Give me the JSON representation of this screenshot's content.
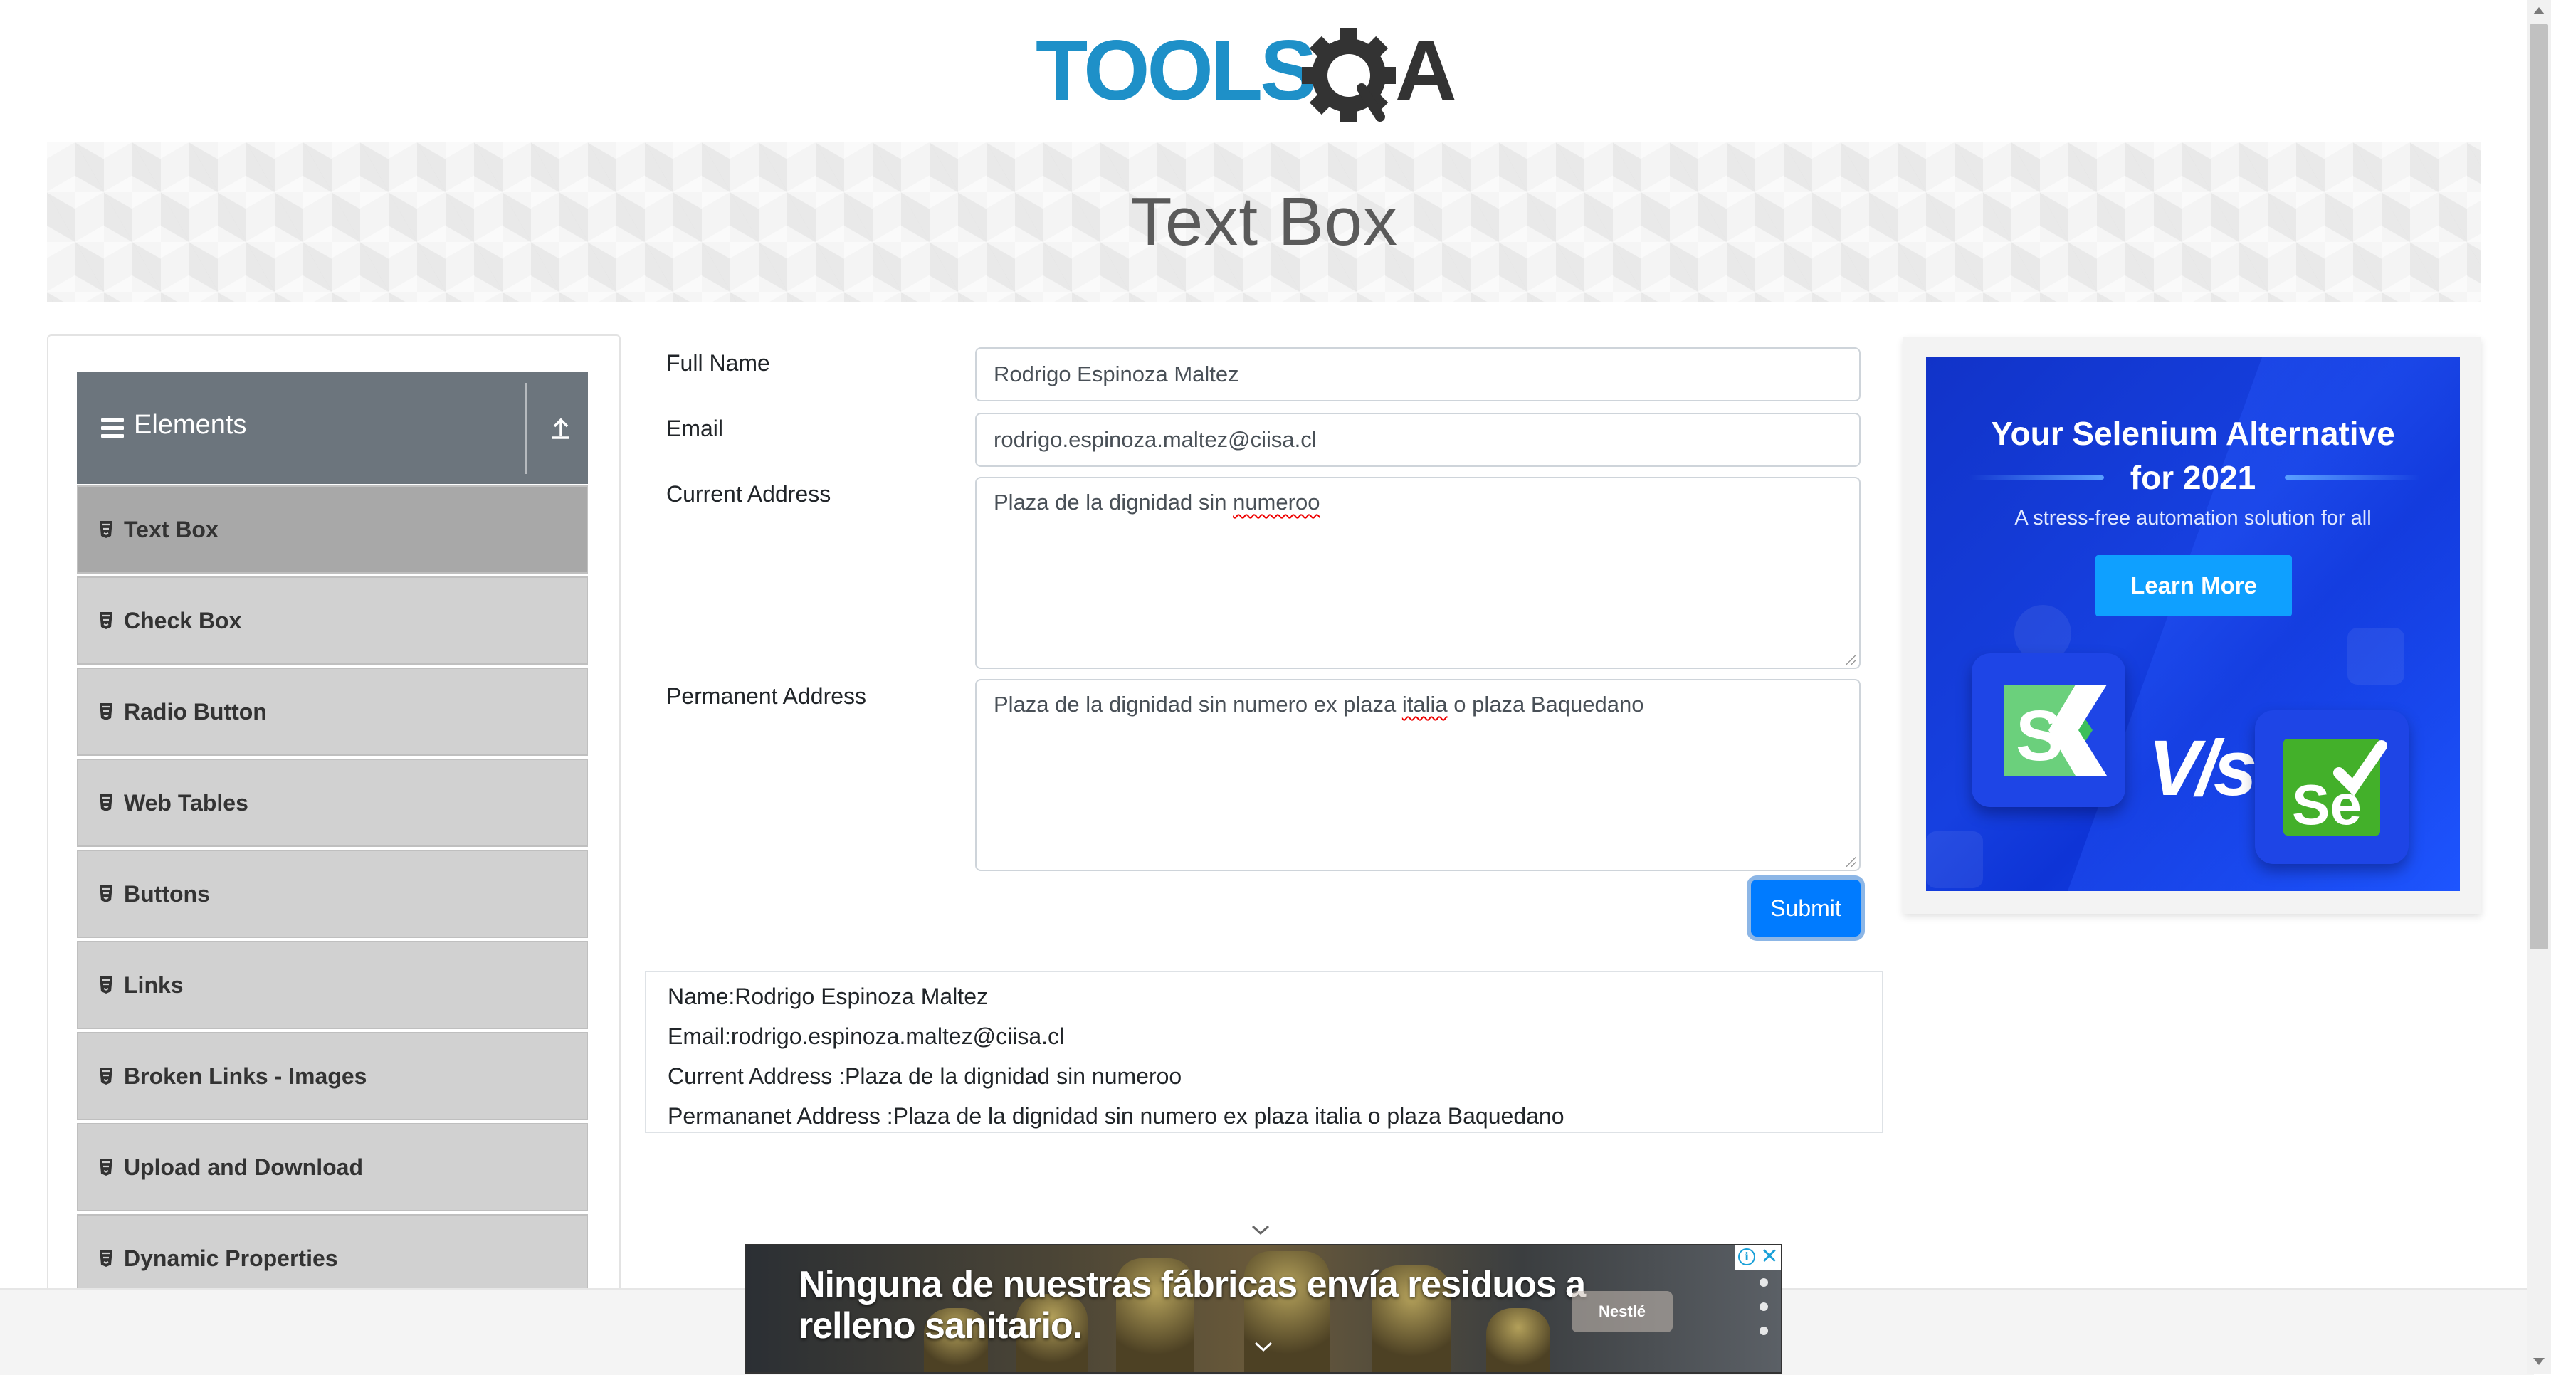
{
  "logo": {
    "text_tools": "TOOLS",
    "text_qa": "QA",
    "color_primary": "#1e90c8",
    "color_secondary": "#333333"
  },
  "page_title": "Text Box",
  "sidebar": {
    "group_title": "Elements",
    "items": [
      {
        "label": "Text Box",
        "active": true
      },
      {
        "label": "Check Box"
      },
      {
        "label": "Radio Button"
      },
      {
        "label": "Web Tables"
      },
      {
        "label": "Buttons"
      },
      {
        "label": "Links"
      },
      {
        "label": "Broken Links - Images"
      },
      {
        "label": "Upload and Download"
      },
      {
        "label": "Dynamic Properties"
      }
    ]
  },
  "form": {
    "full_name_label": "Full Name",
    "full_name_value": "Rodrigo Espinoza Maltez",
    "email_label": "Email",
    "email_value": "rodrigo.espinoza.maltez@ciisa.cl",
    "current_address_label": "Current Address",
    "current_address_plain": "Plaza de la dignidad sin ",
    "current_address_flagged": "numeroo",
    "permanent_address_label": "Permanent Address",
    "permanent_address_before": "Plaza de la dignidad sin numero ex plaza ",
    "permanent_address_flagged": "italia",
    "permanent_address_after": " o plaza Baquedano",
    "submit_label": "Submit"
  },
  "output": {
    "name": "Name:Rodrigo Espinoza Maltez",
    "email": "Email:rodrigo.espinoza.maltez@ciisa.cl",
    "current_address": "Current Address :Plaza de la dignidad sin numeroo",
    "permanent_address": "Permananet Address :Plaza de la dignidad sin numero ex plaza italia o plaza Baquedano"
  },
  "side_ad": {
    "headline_line1": "Your Selenium Alternative",
    "headline_line2": "for 2021",
    "subtitle": "A stress-free automation solution for all",
    "cta": "Learn More",
    "vs": "V/s",
    "accent": "#0fa0ff"
  },
  "bottom_ad": {
    "headline_line1": "Ninguna de nuestras fábricas envía residuos a",
    "headline_line2": "relleno sanitario.",
    "brand": "Nestlé"
  },
  "icons": {
    "menu": "hamburger-icon",
    "collapse": "arrow-up-icon",
    "item": "html5-icon",
    "ad_info": "info-icon",
    "ad_close": "close-icon"
  }
}
